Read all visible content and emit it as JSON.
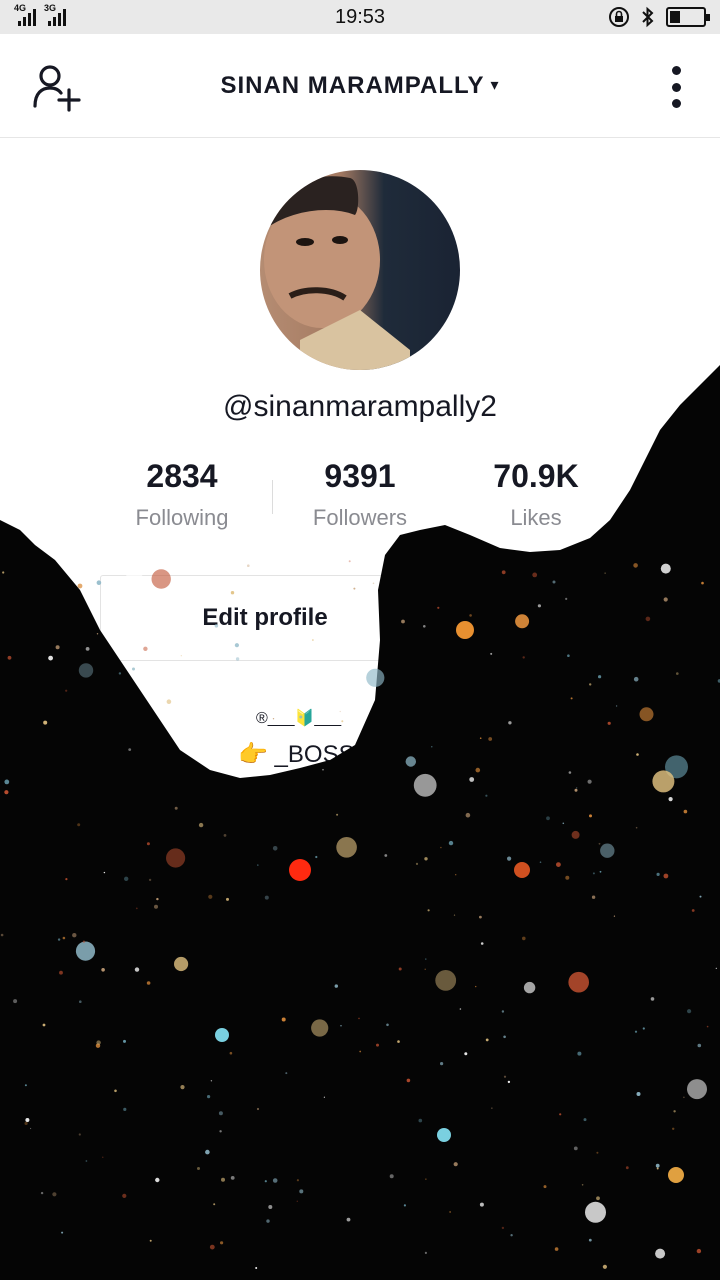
{
  "status_bar": {
    "network_labels": [
      "4G",
      "3G"
    ],
    "time": "19:53",
    "icons": [
      "lock-rotation-icon",
      "bluetooth-icon",
      "battery-icon"
    ],
    "battery_level": 0.3
  },
  "header": {
    "title": "SINAN MARAMPALLY",
    "caret": "▾",
    "left_icon": "add-user-icon",
    "right_icon": "more-vertical-icon"
  },
  "profile": {
    "username": "@sinanmarampally2",
    "stats": [
      {
        "value": "2834",
        "label": "Following"
      },
      {
        "value": "9391",
        "label": "Followers"
      },
      {
        "value": "70.9K",
        "label": "Likes"
      }
    ],
    "edit_button": "Edit profile",
    "bio_line1": "®___🔰___",
    "bio_line2": "👉 _BOSS"
  },
  "colors": {
    "primary_text": "#161823",
    "secondary_text": "#8a8b91",
    "header_border": "#e6e6e6",
    "overlay_dark": "#050505"
  }
}
